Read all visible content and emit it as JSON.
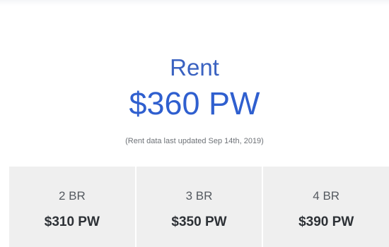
{
  "rent": {
    "heading": "Rent",
    "price": "$360 PW",
    "updated_note": "(Rent data last updated Sep 14th, 2019)"
  },
  "breakdown": [
    {
      "label": "2 BR",
      "price": "$310 PW"
    },
    {
      "label": "3 BR",
      "price": "$350 PW"
    },
    {
      "label": "4 BR",
      "price": "$390 PW"
    }
  ],
  "colors": {
    "accent": "#2f5fcf",
    "cell_background": "#efefef",
    "note_text": "#6e7277"
  }
}
